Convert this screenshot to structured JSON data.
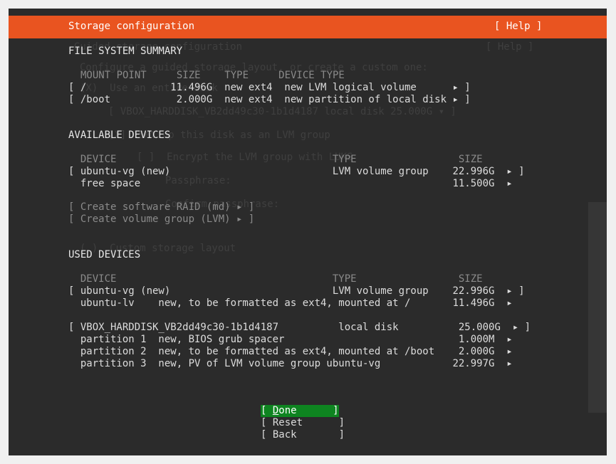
{
  "window": {
    "title": "Storage configuration",
    "help_label": "[ Help ]"
  },
  "summary": {
    "heading": "FILE SYSTEM SUMMARY",
    "columns": "MOUNT POINT     SIZE    TYPE     DEVICE TYPE",
    "rows": [
      {
        "text": "[ /              11.496G  new ext4  new LVM logical volume      ▸ ]"
      },
      {
        "text": "[ /boot           2.000G  new ext4  new partition of local disk ▸ ]"
      }
    ]
  },
  "available": {
    "heading": "AVAILABLE DEVICES",
    "columns": "  DEVICE                                    TYPE                 SIZE",
    "rows": [
      {
        "text": "[ ubuntu-vg (new)                           LVM volume group    22.996G  ▸ ]"
      },
      {
        "text": "  free space                                                    11.500G  ▸"
      }
    ],
    "actions": [
      {
        "text": "[ Create software RAID (md) ▸ ]"
      },
      {
        "text": "[ Create volume group (LVM) ▸ ]"
      }
    ]
  },
  "used": {
    "heading": "USED DEVICES",
    "columns": "  DEVICE                                    TYPE                 SIZE",
    "rows": [
      {
        "text": "[ ubuntu-vg (new)                           LVM volume group    22.996G  ▸ ]"
      },
      {
        "text": "  ubuntu-lv    new, to be formatted as ext4, mounted at /       11.496G  ▸"
      },
      {
        "text": "[ VBOX_HARDDISK_VB2dd49c30-1b1d4187          local disk          25.000G  ▸ ]"
      },
      {
        "text": "  partition 1  new, BIOS grub spacer                             1.000M  ▸"
      },
      {
        "text": "  partition 2  new, to be formatted as ext4, mounted at /boot    2.000G  ▸"
      },
      {
        "text": "  partition 3  new, PV of LVM volume group ubuntu-vg            22.997G  ▸"
      }
    ]
  },
  "buttons": {
    "done_open": "[ ",
    "done_accel": "D",
    "done_rest": "one      ]",
    "reset": "[ Reset      ]",
    "back": "[ Back       ]"
  },
  "background_ghost": {
    "title": "Guided storage configuration",
    "help": "[ Help ]",
    "intro": "Configure a guided storage layout, or create a custom one:",
    "use_entire": "(X)  Use an entire disk",
    "disk": "[ VBOX_HARDDISK_VB2dd49c30-1b1d4187 local disk 25.000G ▾ ]",
    "lvm": "[X]  Set up this disk as an LVM group",
    "encrypt": "[ ]  Encrypt the LVM group with LUKS",
    "passphrase": "Passphrase:",
    "confirm": "Confirm passphrase:",
    "custom": "( )  Custom storage layout"
  }
}
